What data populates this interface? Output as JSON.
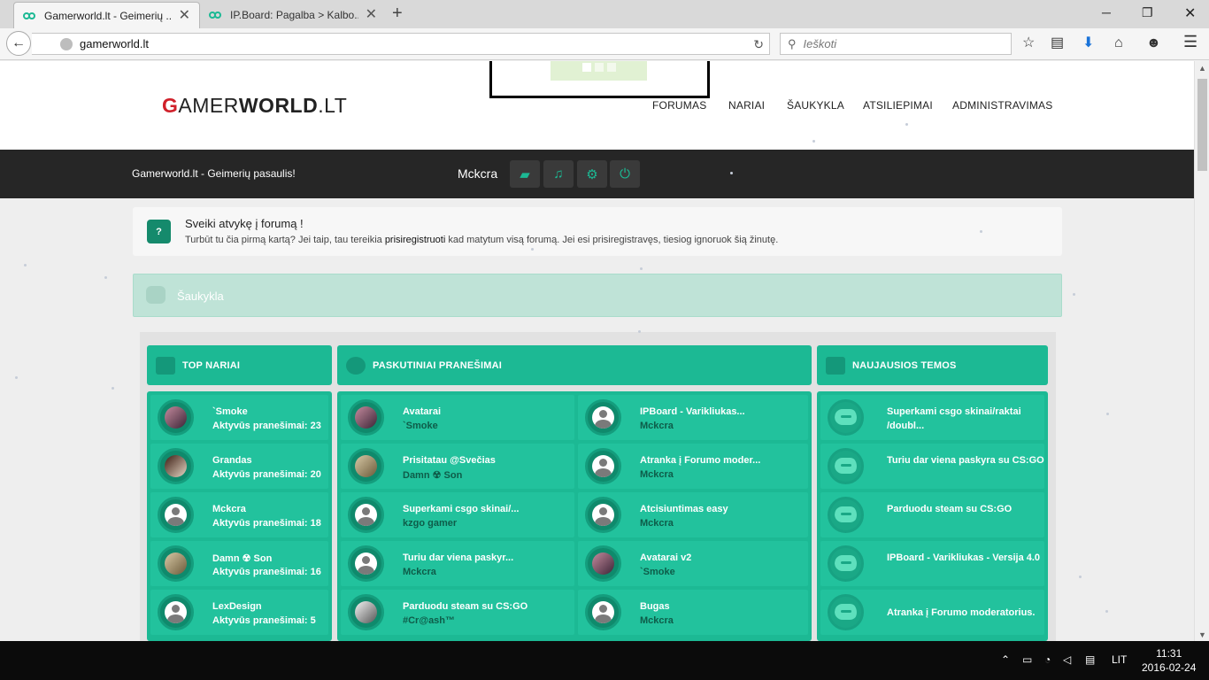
{
  "browser": {
    "tabs": [
      {
        "title": "Gamerworld.lt - Geimerių ..."
      },
      {
        "title": "IP.Board: Pagalba > Kalbo..."
      }
    ],
    "url": "gamerworld.lt",
    "search_placeholder": "Ieškoti"
  },
  "site": {
    "logo": {
      "g": "G",
      "amer": "AMER",
      "world": "WORLD",
      "tld": ".LT"
    },
    "nav": [
      "FORUMAS",
      "NARIAI",
      "ŠAUKYKLA",
      "ATSILIEPIMAI",
      "ADMINISTRAVIMAS"
    ],
    "tagline": "Gamerworld.lt - Geimerių pasaulis!",
    "username": "Mckcra",
    "welcome": {
      "icon_text": "?",
      "title": "Sveiki atvykę į forumą !",
      "text_before": "Turbūt tu čia pirmą kartą? Jei taip, tau tereikia ",
      "link": "prisiregistruoti",
      "text_after": " kad matytum visą forumą. Jei esi prisiregistravęs, tiesiog ignoruok šią žinutę."
    },
    "shoutbox_label": "Šaukykla",
    "top_members": {
      "title": "TOP NARIAI",
      "items": [
        {
          "name": "`Smoke",
          "posts": "Aktyvūs pranešimai: 23"
        },
        {
          "name": "Grandas",
          "posts": "Aktyvūs pranešimai: 20"
        },
        {
          "name": "Mckcra",
          "posts": "Aktyvūs pranešimai: 18"
        },
        {
          "name": "Damn ☢ Son",
          "posts": "Aktyvūs pranešimai: 16"
        },
        {
          "name": "LexDesign",
          "posts": "Aktyvūs pranešimai: 5"
        }
      ]
    },
    "latest_posts": {
      "title": "PASKUTINIAI PRANEŠIMAI",
      "left": [
        {
          "topic": "Avatarai",
          "author": "`Smoke"
        },
        {
          "topic": "Prisitatau @Svečias",
          "author": "Damn ☢ Son"
        },
        {
          "topic": "Superkami csgo skinai/...",
          "author": "kzgo gamer"
        },
        {
          "topic": "Turiu dar viena paskyr...",
          "author": "Mckcra"
        },
        {
          "topic": "Parduodu steam su CS:GO",
          "author": "#Cr@ash™"
        }
      ],
      "right": [
        {
          "topic": "IPBoard - Varikliukas...",
          "author": "Mckcra"
        },
        {
          "topic": "Atranka į Forumo moder...",
          "author": "Mckcra"
        },
        {
          "topic": "Atcisiuntimas easy",
          "author": "Mckcra"
        },
        {
          "topic": "Avatarai v2",
          "author": "`Smoke"
        },
        {
          "topic": "Bugas",
          "author": "Mckcra"
        }
      ]
    },
    "new_topics": {
      "title": "NAUJAUSIOS TEMOS",
      "items": [
        {
          "topic": "Superkami csgo skinai/raktai /doubl..."
        },
        {
          "topic": "Turiu dar viena paskyra su CS:GO"
        },
        {
          "topic": "Parduodu steam su CS:GO"
        },
        {
          "topic": "IPBoard - Varikliukas - Versija 4.0"
        },
        {
          "topic": "Atranka į Forumo moderatorius."
        }
      ]
    }
  },
  "taskbar": {
    "language": "LIT",
    "time": "11:31",
    "date": "2016-02-24"
  }
}
